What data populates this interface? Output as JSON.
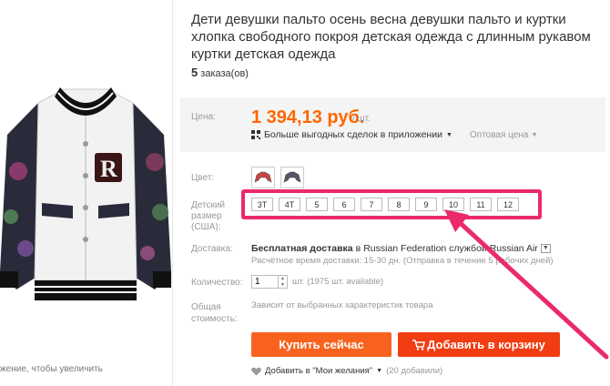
{
  "product": {
    "title": "Дети девушки пальто осень весна девушки пальто и куртки хлопка свободного покроя детская одежда с длинным рукавом куртки детская одежда",
    "orders_count": "5",
    "orders_label": "заказа(ов)"
  },
  "gallery": {
    "zoom_hint": "жение, чтобы увеличить"
  },
  "price": {
    "label": "Цена:",
    "value": "1 394,13 руб.",
    "unit": "/ шт.",
    "app_deal": "Больше выгодных сделок в приложении",
    "wholesale": "Оптовая цена"
  },
  "color": {
    "label": "Цвет:"
  },
  "size": {
    "label": "Детский размер (США):",
    "options": [
      "3T",
      "4T",
      "5",
      "6",
      "7",
      "8",
      "9",
      "10",
      "11",
      "12"
    ]
  },
  "delivery": {
    "label": "Доставка:",
    "free": "Бесплатная доставка",
    "in": "в",
    "dest": "Russian Federation службой Russian Air",
    "time": "Расчётное время доставки: 15-30 дн. (Отправка в течение 5 рабочих дней)"
  },
  "quantity": {
    "label": "Количество:",
    "value": "1",
    "available": "шт. (1975 шт. available)"
  },
  "total": {
    "label": "Общая стоимость:",
    "note": "Зависит от выбранных характеристик товара"
  },
  "actions": {
    "buy_now": "Купить сейчас",
    "add_to_cart": "Добавить в корзину"
  },
  "wishlist": {
    "label": "Добавить в \"Мои желания\"",
    "count": "(20 добавили)"
  },
  "colors": {
    "accent": "#ff6600",
    "buy": "#f7631f",
    "cart": "#f13d12",
    "highlight": "#ea2a6b"
  }
}
